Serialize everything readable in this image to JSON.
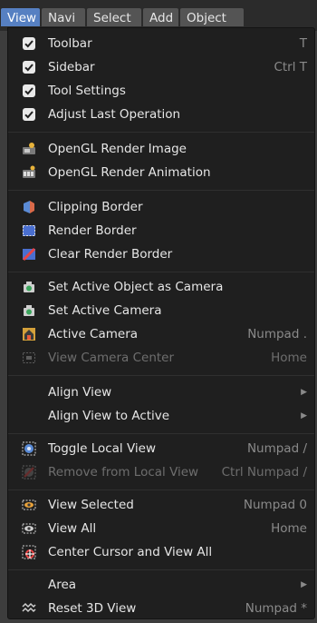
{
  "tabs": [
    {
      "label": "View",
      "active": true
    },
    {
      "label": "Navi",
      "active": false
    },
    {
      "label": "Select",
      "active": false
    },
    {
      "label": "Add",
      "active": false
    },
    {
      "label": "Object",
      "active": false
    }
  ],
  "menu": {
    "toolbar": {
      "label": "Toolbar",
      "shortcut": "T",
      "checked": true
    },
    "sidebar": {
      "label": "Sidebar",
      "shortcut": "Ctrl T",
      "checked": true
    },
    "tool_settings": {
      "label": "Tool Settings",
      "shortcut": "",
      "checked": true
    },
    "adjust_last": {
      "label": "Adjust Last Operation",
      "shortcut": "",
      "checked": true
    },
    "opengl_render_image": {
      "label": "OpenGL Render Image",
      "icon": "render-image-icon"
    },
    "opengl_render_animation": {
      "label": "OpenGL Render Animation",
      "icon": "render-animation-icon"
    },
    "clipping_border": {
      "label": "Clipping Border",
      "icon": "clipping-border-icon"
    },
    "render_border": {
      "label": "Render Border",
      "icon": "render-border-icon"
    },
    "clear_render_border": {
      "label": "Clear Render Border",
      "icon": "clear-border-icon"
    },
    "set_active_object_camera": {
      "label": "Set Active Object as Camera",
      "icon": "camera-icon"
    },
    "set_active_camera": {
      "label": "Set Active Camera",
      "icon": "camera-icon"
    },
    "active_camera": {
      "label": "Active Camera",
      "shortcut": "Numpad .",
      "icon": "active-camera-icon"
    },
    "view_camera_center": {
      "label": "View Camera Center",
      "shortcut": "Home",
      "icon": "camera-center-icon",
      "disabled": true
    },
    "align_view": {
      "label": "Align View"
    },
    "align_view_to_active": {
      "label": "Align View to Active"
    },
    "toggle_local_view": {
      "label": "Toggle Local View",
      "shortcut": "Numpad /",
      "icon": "local-view-icon"
    },
    "remove_from_local_view": {
      "label": "Remove from Local View",
      "shortcut": "Ctrl Numpad /",
      "icon": "remove-local-icon",
      "disabled": true
    },
    "view_selected": {
      "label": "View Selected",
      "shortcut": "Numpad 0",
      "icon": "view-selected-icon"
    },
    "view_all": {
      "label": "View All",
      "shortcut": "Home",
      "icon": "view-all-icon"
    },
    "center_cursor_view_all": {
      "label": "Center Cursor and View All",
      "icon": "center-cursor-icon"
    },
    "area": {
      "label": "Area"
    },
    "reset_3d_view": {
      "label": "Reset 3D View",
      "shortcut": "Numpad *",
      "icon": "reset-view-icon"
    }
  },
  "colors": {
    "accent": "#5680c2",
    "menu_bg": "#1f1f1f",
    "text": "#e6e6e6",
    "shortcut": "#8a8a8a"
  }
}
